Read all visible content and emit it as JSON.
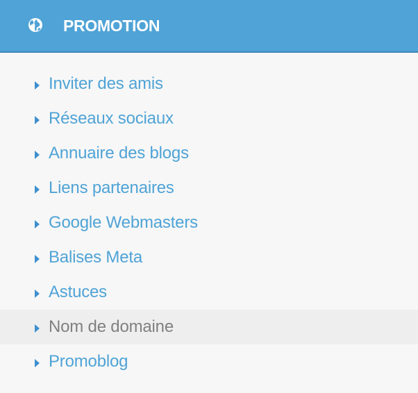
{
  "header": {
    "title": "PROMOTION",
    "icon": "globe-icon"
  },
  "menu": {
    "items": [
      {
        "label": "Inviter des amis",
        "active": false
      },
      {
        "label": "Réseaux sociaux",
        "active": false
      },
      {
        "label": "Annuaire des blogs",
        "active": false
      },
      {
        "label": "Liens partenaires",
        "active": false
      },
      {
        "label": "Google Webmasters",
        "active": false
      },
      {
        "label": "Balises Meta",
        "active": false
      },
      {
        "label": "Astuces",
        "active": false
      },
      {
        "label": "Nom de domaine",
        "active": true
      },
      {
        "label": "Promoblog",
        "active": false
      }
    ]
  },
  "colors": {
    "header_bg": "#4fa3d6",
    "link": "#4fa3d6",
    "active_text": "#808080",
    "arrow": "#3d8fcf",
    "active_bg": "#eeeeee"
  }
}
